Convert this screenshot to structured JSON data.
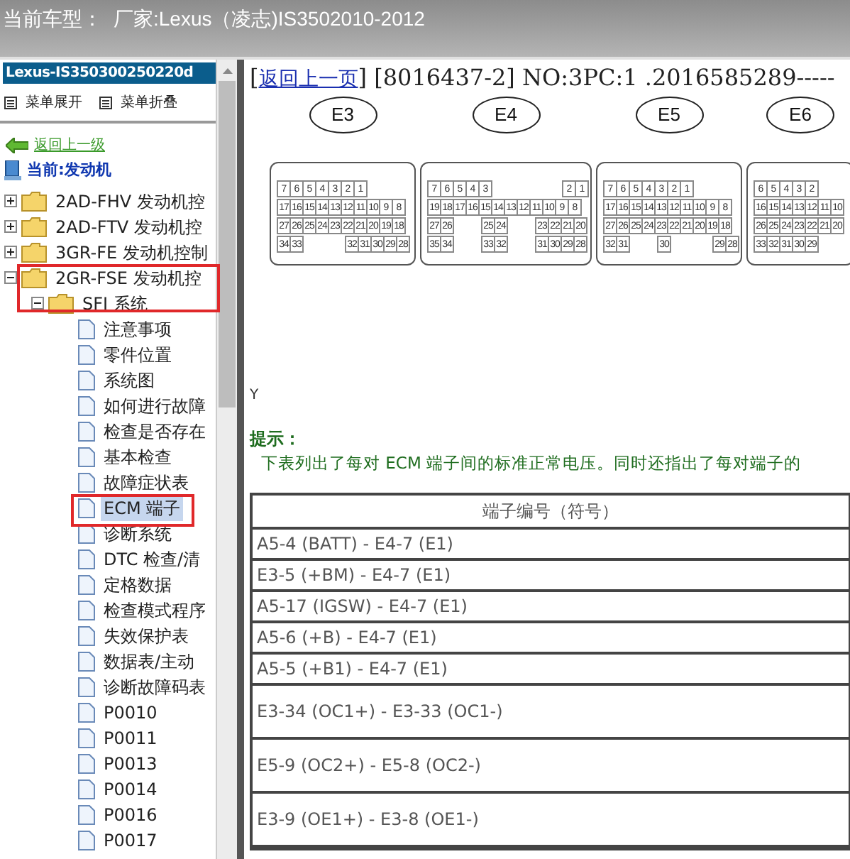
{
  "title_bar": {
    "label": "当前车型：",
    "value": "厂家:Lexus（凌志)IS3502010-2012"
  },
  "sidebar": {
    "header": "Lexus-IS350300250220d",
    "menu": [
      "菜单展开",
      "菜单折叠"
    ],
    "back_link": "返回上一级",
    "current": "当前:发动机",
    "tree": [
      {
        "label": "2AD-FHV 发动机控",
        "expanded": false,
        "selected": false
      },
      {
        "label": "2AD-FTV 发动机控",
        "expanded": false,
        "selected": false
      },
      {
        "label": "3GR-FE 发动机控制",
        "expanded": false,
        "selected": false
      },
      {
        "label": "2GR-FSE 发动机控",
        "expanded": true,
        "selected": false,
        "children": [
          {
            "label": "SFI 系统",
            "expanded": true,
            "selected": false,
            "children": [
              {
                "label": "注意事项",
                "selected": false
              },
              {
                "label": "零件位置",
                "selected": false
              },
              {
                "label": "系统图",
                "selected": false
              },
              {
                "label": "如何进行故障",
                "selected": false
              },
              {
                "label": "检查是否存在",
                "selected": false
              },
              {
                "label": "基本检查",
                "selected": false
              },
              {
                "label": "故障症状表",
                "selected": false
              },
              {
                "label": "ECM 端子",
                "selected": true
              },
              {
                "label": "诊断系统",
                "selected": false
              },
              {
                "label": "DTC 检查/清",
                "selected": false
              },
              {
                "label": "定格数据",
                "selected": false
              },
              {
                "label": "检查模式程序",
                "selected": false
              },
              {
                "label": "失效保护表",
                "selected": false
              },
              {
                "label": "数据表/主动",
                "selected": false
              },
              {
                "label": "诊断故障码表",
                "selected": false
              },
              {
                "label": "P0010",
                "selected": false
              },
              {
                "label": "P0011",
                "selected": false
              },
              {
                "label": "P0013",
                "selected": false
              },
              {
                "label": "P0014",
                "selected": false
              },
              {
                "label": "P0016",
                "selected": false
              },
              {
                "label": "P0017",
                "selected": false
              }
            ]
          }
        ]
      }
    ]
  },
  "content": {
    "open_bracket": "[",
    "back_link": "返回上一页",
    "close_bracket": "]",
    "doc_info": "[8016437-2] NO:3PC:1 .2016585289-----",
    "connectors": [
      {
        "label": "E3",
        "rows": [
          [
            "7",
            "6",
            "5",
            "4",
            "3",
            "2",
            "1"
          ],
          [
            "17",
            "16",
            "15",
            "14",
            "13",
            "12",
            "11",
            "10",
            "9",
            "8"
          ],
          [
            "27",
            "26",
            "25",
            "24",
            "23",
            "22",
            "21",
            "20",
            "19",
            "18"
          ],
          [
            "34",
            "33",
            "",
            "",
            "",
            "32",
            "31",
            "30",
            "29",
            "28"
          ]
        ]
      },
      {
        "label": "E4",
        "rows": [
          [
            "7",
            "6",
            "5",
            "4",
            "3",
            "",
            "",
            "",
            "",
            "",
            "2",
            "1"
          ],
          [
            "19",
            "18",
            "17",
            "16",
            "15",
            "14",
            "13",
            "12",
            "11",
            "10",
            "9",
            "8"
          ],
          [
            "27",
            "26",
            "",
            "",
            "25",
            "24",
            "",
            "",
            "23",
            "22",
            "21",
            "20"
          ],
          [
            "35",
            "34",
            "",
            "",
            "33",
            "32",
            "",
            "",
            "31",
            "30",
            "29",
            "28"
          ]
        ]
      },
      {
        "label": "E5",
        "rows": [
          [
            "7",
            "6",
            "5",
            "4",
            "3",
            "2",
            "1"
          ],
          [
            "17",
            "16",
            "15",
            "14",
            "13",
            "12",
            "11",
            "10",
            "9",
            "8"
          ],
          [
            "27",
            "26",
            "25",
            "24",
            "23",
            "22",
            "21",
            "20",
            "19",
            "18"
          ],
          [
            "32",
            "31",
            "",
            "",
            "30",
            "",
            "",
            "",
            "29",
            "28"
          ]
        ]
      },
      {
        "label": "E6",
        "rows": [
          [
            "6",
            "5",
            "4",
            "3",
            "2"
          ],
          [
            "16",
            "15",
            "14",
            "13",
            "12",
            "11",
            "10"
          ],
          [
            "26",
            "25",
            "24",
            "23",
            "22",
            "21",
            "20"
          ],
          [
            "33",
            "32",
            "31",
            "30",
            "29"
          ]
        ]
      }
    ],
    "marker": "Y",
    "hint_title": "提示：",
    "hint_text": "下表列出了每对 ECM 端子间的标准正常电压。同时还指出了每对端子的",
    "table": {
      "columns": [
        "端子编号（符号）"
      ],
      "rows": [
        "A5-4 (BATT) - E4-7 (E1)",
        "E3-5 (+BM) - E4-7 (E1)",
        "A5-17 (IGSW) - E4-7 (E1)",
        "A5-6 (+B) - E4-7 (E1)",
        "A5-5 (+B1) - E4-7 (E1)",
        "E3-34 (OC1+) - E3-33 (OC1-)",
        "E5-9 (OC2+) - E5-8 (OC2-)",
        "E3-9 (OE1+) - E3-8 (OE1-)"
      ]
    }
  }
}
